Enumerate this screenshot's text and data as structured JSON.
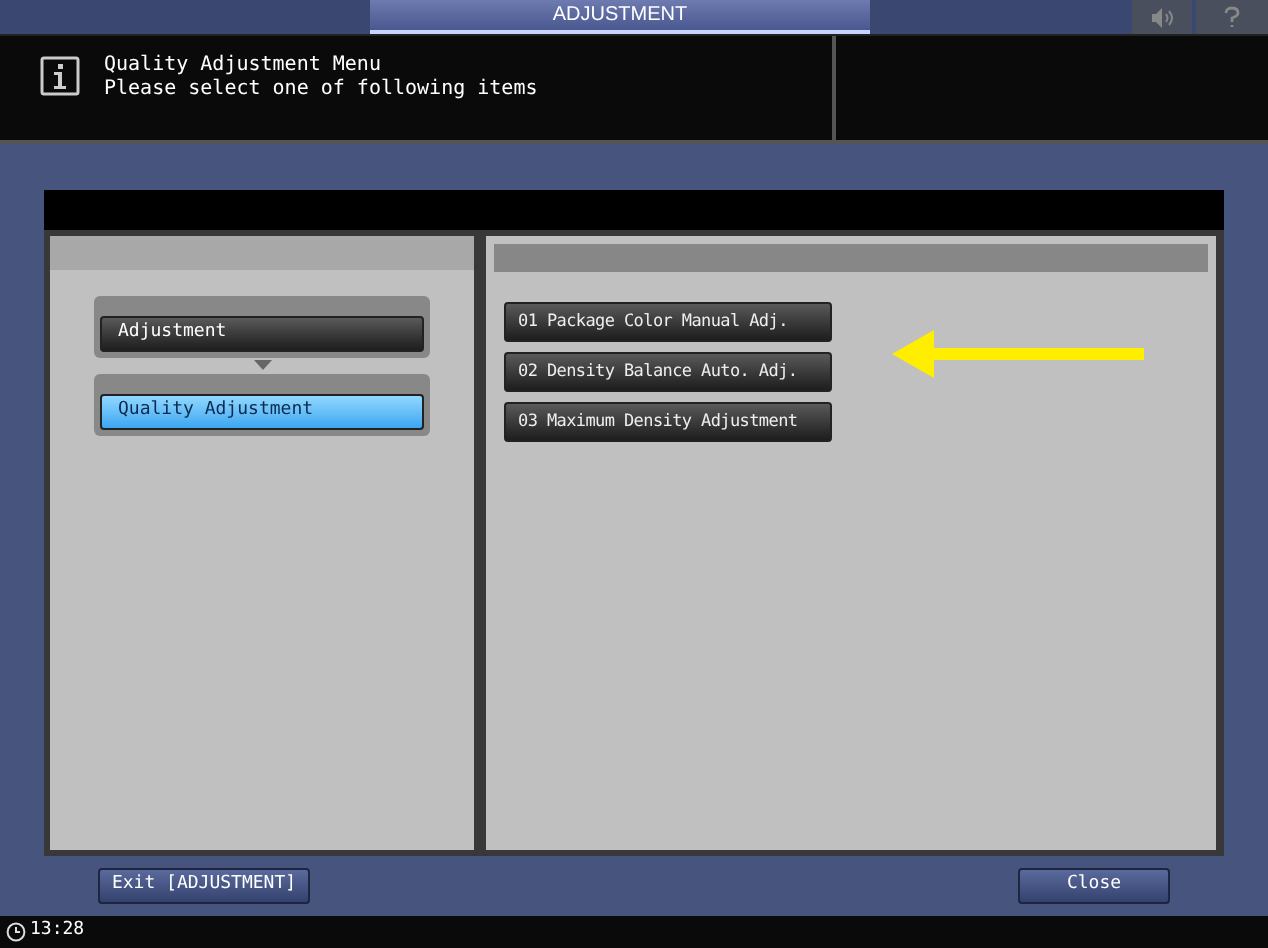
{
  "header": {
    "title": "ADJUSTMENT"
  },
  "message": {
    "lines": [
      "Quality Adjustment Menu",
      "Please select one of following items"
    ]
  },
  "breadcrumb": [
    {
      "label": "Adjustment",
      "selected": false
    },
    {
      "label": "Quality Adjustment",
      "selected": true
    }
  ],
  "items": [
    "01 Package Color Manual Adj.",
    "02 Density Balance Auto. Adj.",
    "03 Maximum Density Adjustment"
  ],
  "footer": {
    "exit": "Exit [ADJUSTMENT]",
    "close": "Close"
  },
  "status_bar": {
    "time": "13:28"
  }
}
